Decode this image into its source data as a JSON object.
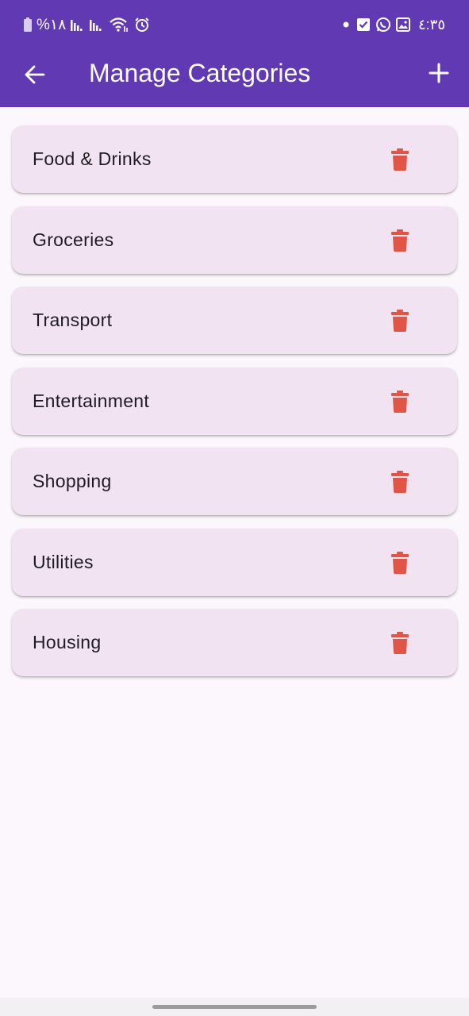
{
  "status_bar": {
    "battery_percent": "%١٨",
    "time": "٤:٣٥"
  },
  "header": {
    "title": "Manage Categories"
  },
  "categories": [
    {
      "label": "Food & Drinks"
    },
    {
      "label": "Groceries"
    },
    {
      "label": "Transport"
    },
    {
      "label": "Entertainment"
    },
    {
      "label": "Shopping"
    },
    {
      "label": "Utilities"
    },
    {
      "label": "Housing"
    }
  ],
  "icons": {
    "back": "arrow-back-icon",
    "add": "plus-icon",
    "delete": "trash-icon"
  },
  "colors": {
    "app_bar": "#6139b3",
    "card": "#f1e3f2",
    "delete": "#e05545",
    "background": "#fcf7fc"
  }
}
